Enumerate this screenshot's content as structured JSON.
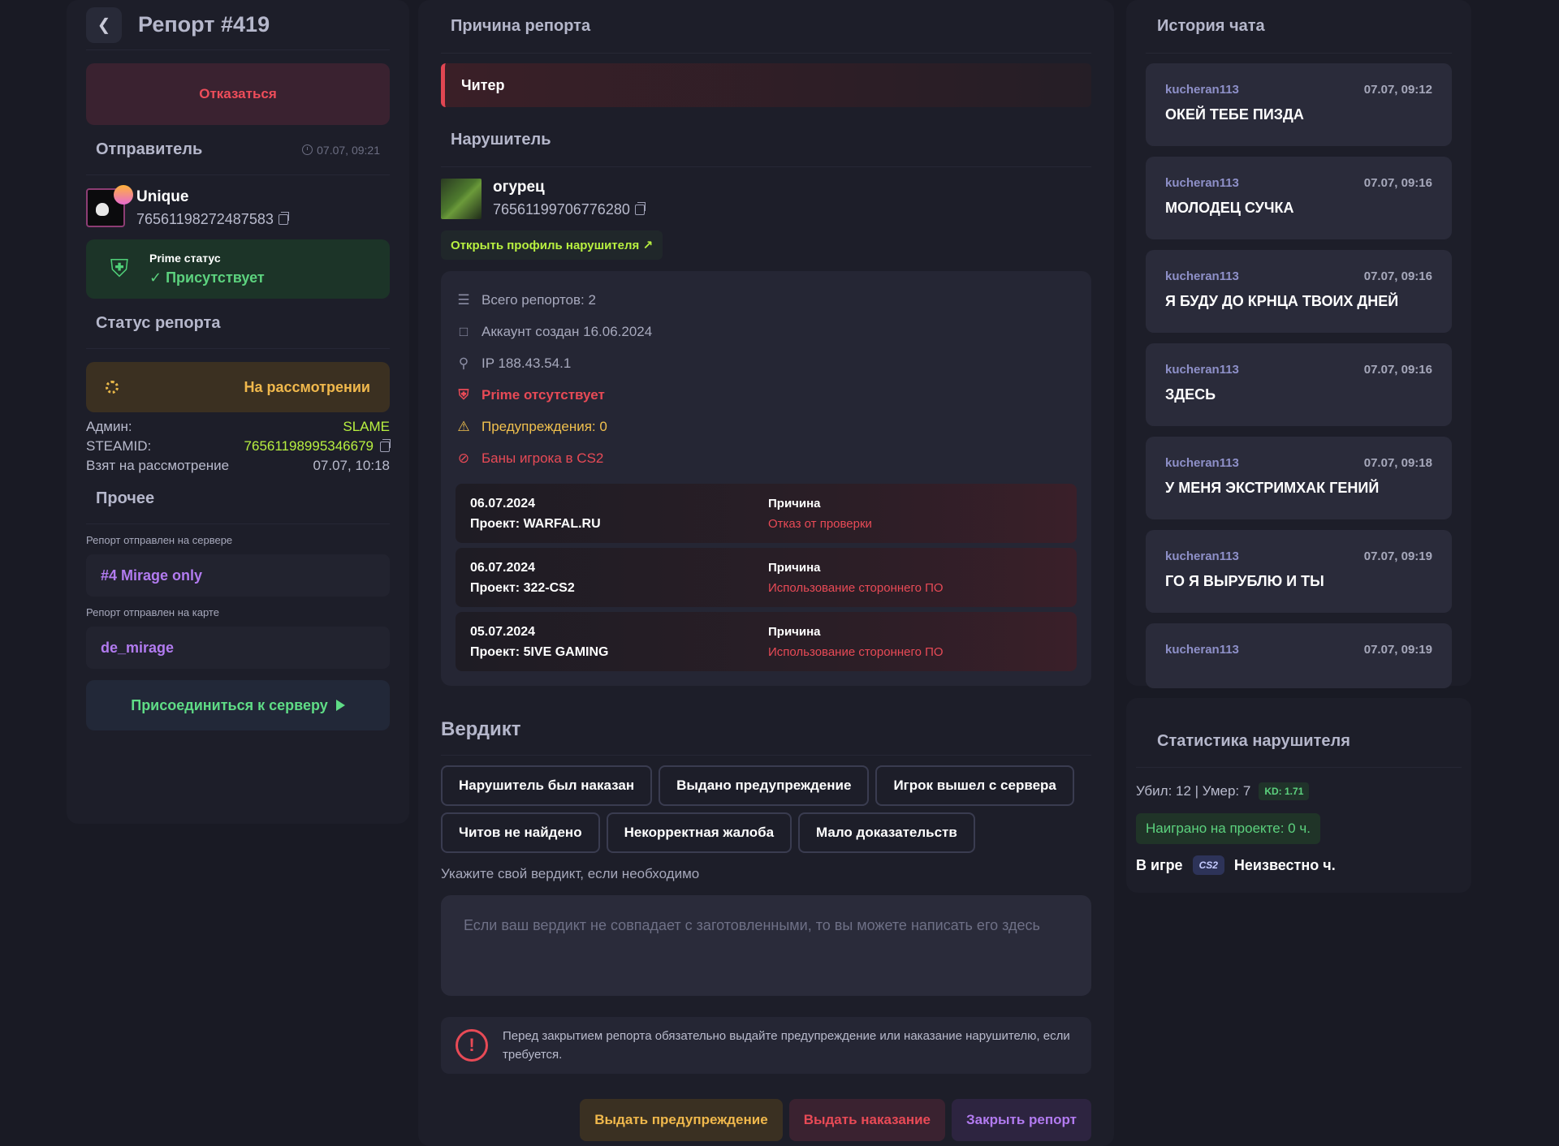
{
  "header": {
    "title": "Репорт #419",
    "refuse_label": "Отказаться"
  },
  "sender": {
    "section_title": "Отправитель",
    "time": "07.07, 09:21",
    "name": "Unique",
    "steamid": "76561198272487583",
    "prime_label": "Prime статус",
    "prime_value": "Присутствует"
  },
  "report_status": {
    "section_title": "Статус репорта",
    "status": "На рассмотрении",
    "admin_label": "Админ:",
    "admin_value": "SLAME",
    "steamid_label": "STEAMID:",
    "steamid_value": "76561198995346679",
    "taken_label": "Взят на рассмотрение",
    "taken_value": "07.07, 10:18"
  },
  "other": {
    "section_title": "Прочее",
    "server_label": "Репорт отправлен на сервере",
    "server_value": "#4 Mirage only",
    "map_label": "Репорт отправлен на карте",
    "map_value": "de_mirage",
    "join_label": "Присоединиться к серверу"
  },
  "reason": {
    "section_title": "Причина репорта",
    "value": "Читер"
  },
  "violator": {
    "section_title": "Нарушитель",
    "name": "огурец",
    "steamid": "76561199706776280",
    "open_profile_label": "Открыть профиль нарушителя ↗",
    "info": {
      "total_reports": "Всего репортов: 2",
      "account_created": "Аккаунт создан 16.06.2024",
      "ip": "IP 188.43.54.1",
      "prime": "Prime отсутствует",
      "warnings": "Предупреждения: 0",
      "bans_title": "Баны игрока в CS2"
    },
    "bans": [
      {
        "date": "06.07.2024",
        "project": "Проект: WARFAL.RU",
        "reason_label": "Причина",
        "reason": "Отказ от проверки"
      },
      {
        "date": "06.07.2024",
        "project": "Проект: 322-CS2",
        "reason_label": "Причина",
        "reason": "Использование стороннего ПО"
      },
      {
        "date": "05.07.2024",
        "project": "Проект: 5IVE GAMING",
        "reason_label": "Причина",
        "reason": "Использование стороннего ПО"
      }
    ]
  },
  "verdict": {
    "section_title": "Вердикт",
    "options": [
      "Нарушитель был наказан",
      "Выдано предупреждение",
      "Игрок вышел с сервера",
      "Читов не найдено",
      "Некорректная жалоба",
      "Мало доказательств"
    ],
    "hint": "Укажите свой вердикт, если необходимо",
    "placeholder": "Если ваш вердикт не совпадает с заготовленными, то вы можете написать его здесь",
    "warning": "Перед закрытием репорта обязательно выдайте предупреждение или наказание нарушителю, если требуется.",
    "warning_icon": "!",
    "btn_warn": "Выдать предупреждение",
    "btn_punish": "Выдать наказание",
    "btn_close": "Закрыть репорт"
  },
  "chat": {
    "section_title": "История чата",
    "messages": [
      {
        "user": "kucheran113",
        "time": "07.07, 09:12",
        "text": "ОКЕЙ ТЕБЕ ПИЗДА"
      },
      {
        "user": "kucheran113",
        "time": "07.07, 09:16",
        "text": "МОЛОДЕЦ СУЧКА"
      },
      {
        "user": "kucheran113",
        "time": "07.07, 09:16",
        "text": "Я БУДУ ДО КРНЦА ТВОИХ ДНЕЙ"
      },
      {
        "user": "kucheran113",
        "time": "07.07, 09:16",
        "text": "ЗДЕСЬ"
      },
      {
        "user": "kucheran113",
        "time": "07.07, 09:18",
        "text": "У МЕНЯ ЭКСТРИМХАК ГЕНИЙ"
      },
      {
        "user": "kucheran113",
        "time": "07.07, 09:19",
        "text": "ГО Я ВЫРУБЛЮ И ТЫ"
      },
      {
        "user": "kucheran113",
        "time": "07.07, 09:19",
        "text": ""
      }
    ]
  },
  "stats": {
    "section_title": "Статистика нарушителя",
    "kills_deaths": "Убил: 12 | Умер: 7",
    "kd": "KD: 1.71",
    "played": "Наиграно на проекте: 0 ч.",
    "ingame_label": "В игре",
    "game_badge": "CS2",
    "ingame_value": "Неизвестно ч."
  },
  "colors": {
    "background": "#191a24",
    "panel": "#1d1e29",
    "accent_green": "#5cd27e",
    "accent_lime": "#b8f040",
    "accent_red": "#e84a56",
    "accent_yellow": "#f0b84c",
    "accent_purple": "#b27bf0"
  },
  "icons": [
    "chevron-left-icon",
    "clock-icon",
    "copy-icon",
    "prime-shield-icon",
    "check-icon",
    "spinner-icon",
    "play-icon",
    "reports-icon",
    "calendar-icon",
    "location-icon",
    "prime-off-icon",
    "warning-icon",
    "ban-icon",
    "alert-circle-icon"
  ]
}
